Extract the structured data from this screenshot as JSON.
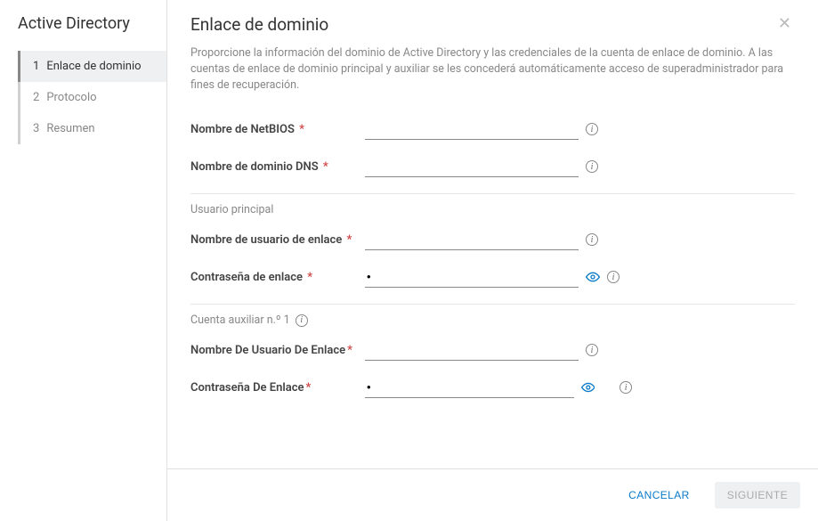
{
  "sidebar": {
    "title": "Active Directory",
    "steps": [
      {
        "num": "1",
        "label": "Enlace de dominio",
        "active": true
      },
      {
        "num": "2",
        "label": "Protocolo",
        "active": false
      },
      {
        "num": "3",
        "label": "Resumen",
        "active": false
      }
    ]
  },
  "header": {
    "title": "Enlace de dominio"
  },
  "description": "Proporcione la información del dominio de Active Directory y las credenciales de la cuenta de enlace de dominio. A las cuentas de enlace de dominio principal y auxiliar se les concederá automáticamente acceso de superadministrador para fines de recuperación.",
  "fields": {
    "netbios": {
      "label": "Nombre de NetBIOS",
      "required": true,
      "value": ""
    },
    "dnsdomain": {
      "label": "Nombre de dominio DNS",
      "required": true,
      "value": ""
    }
  },
  "section_primary": {
    "title": "Usuario principal",
    "username": {
      "label": "Nombre de usuario de enlace",
      "required": true,
      "value": ""
    },
    "password": {
      "label": "Contraseña de enlace",
      "required": true,
      "value": "•"
    }
  },
  "section_aux": {
    "title": "Cuenta auxiliar n.º 1",
    "username": {
      "label": "Nombre De Usuario De Enlace",
      "required": true,
      "value": ""
    },
    "password": {
      "label": "Contraseña De Enlace",
      "required": true,
      "value": "•"
    }
  },
  "footer": {
    "cancel": "CANCELAR",
    "next": "SIGUIENTE"
  }
}
